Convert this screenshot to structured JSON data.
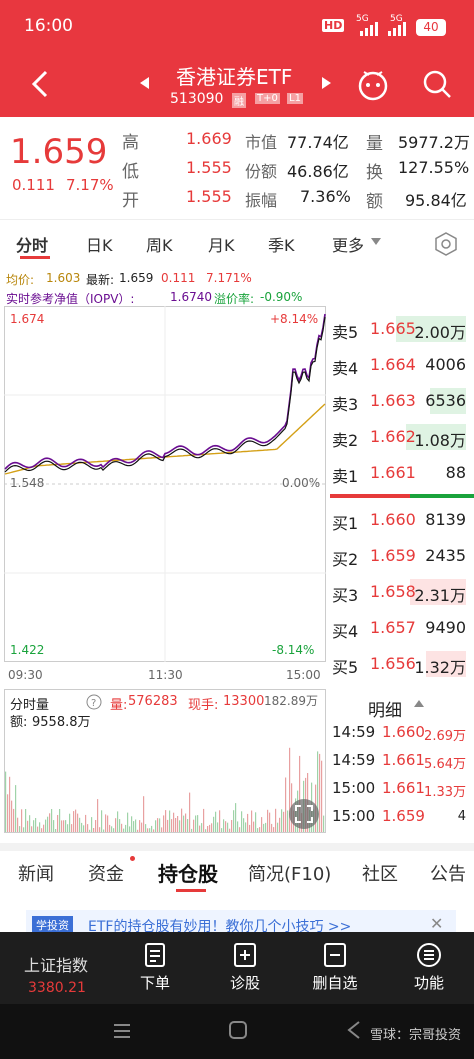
{
  "status": {
    "time": "16:00",
    "battery": "40",
    "sig1": "5G",
    "sig2": "5G",
    "hd": "HD"
  },
  "nav": {
    "title": "香港证券ETF",
    "code": "513090",
    "badges": [
      "融",
      "T+0",
      "L1"
    ]
  },
  "quote": {
    "price": "1.659",
    "change": "0.111",
    "pct": "7.17%",
    "labels": {
      "high": "高",
      "low": "低",
      "open": "开",
      "mcap": "市值",
      "shares": "份额",
      "amp": "振幅",
      "vol": "量",
      "turn": "换",
      "amt": "额"
    },
    "high": "1.669",
    "low": "1.555",
    "open": "1.555",
    "mcap": "77.74亿",
    "shares": "46.86亿",
    "amp": "7.36%",
    "vol": "5977.2万",
    "turn": "127.55%",
    "amt": "95.84亿"
  },
  "tabs": {
    "t1": "分时",
    "t2": "日K",
    "t3": "周K",
    "t4": "月K",
    "t5": "季K",
    "t6": "更多"
  },
  "chart_info": {
    "avg_label": "均价:",
    "avg": "1.603",
    "latest_label": "最新:",
    "latest": "1.659",
    "chg": "0.111",
    "pct": "7.171%",
    "iopv_label": "实时参考净值（IOPV）:",
    "iopv": "1.6740",
    "prem_label": "溢价率:",
    "prem": "-0.90%"
  },
  "chart_data": {
    "type": "line",
    "x_ticks": [
      "09:30",
      "11:30",
      "15:00"
    ],
    "y_top": "1.674",
    "y_mid": "1.548",
    "y_bot": "1.422",
    "pct_top": "+8.14%",
    "pct_mid": "0.00%",
    "pct_bot": "-8.14%",
    "ylim": [
      1.422,
      1.674
    ],
    "series": []
  },
  "orderbook": {
    "sell": [
      {
        "l": "卖5",
        "p": "1.665",
        "v": "2.00万"
      },
      {
        "l": "卖4",
        "p": "1.664",
        "v": "4006"
      },
      {
        "l": "卖3",
        "p": "1.663",
        "v": "6536"
      },
      {
        "l": "卖2",
        "p": "1.662",
        "v": "1.08万"
      },
      {
        "l": "卖1",
        "p": "1.661",
        "v": "88"
      }
    ],
    "buy": [
      {
        "l": "买1",
        "p": "1.660",
        "v": "8139"
      },
      {
        "l": "买2",
        "p": "1.659",
        "v": "2435"
      },
      {
        "l": "买3",
        "p": "1.658",
        "v": "2.31万"
      },
      {
        "l": "买4",
        "p": "1.657",
        "v": "9490"
      },
      {
        "l": "买5",
        "p": "1.656",
        "v": "1.32万"
      }
    ]
  },
  "volume": {
    "label": "分时量",
    "q_label": "量:",
    "q": "576283",
    "now_label": "现手:",
    "now": "13300",
    "amt_label": "额:",
    "amt": "9558.8万",
    "max": "182.89万"
  },
  "detail": {
    "title": "明细",
    "rows": [
      {
        "t": "14:59",
        "p": "1.660",
        "v": "2.69万"
      },
      {
        "t": "14:59",
        "p": "1.661",
        "v": "5.64万"
      },
      {
        "t": "15:00",
        "p": "1.661",
        "v": "1.33万"
      },
      {
        "t": "15:00",
        "p": "1.659",
        "v": "4"
      }
    ]
  },
  "subtabs": {
    "s1": "新闻",
    "s2": "资金",
    "s3": "持仓股",
    "s4": "简况(F10)",
    "s5": "社区",
    "s6": "公告"
  },
  "banner": {
    "tag": "学投资",
    "text": "ETF的持仓股有妙用！教你几个小技巧 >>"
  },
  "dock": {
    "index_name": "上证指数",
    "index_val": "3380.21",
    "b1": "下单",
    "b2": "诊股",
    "b3": "删自选",
    "b4": "功能"
  },
  "watermark": "雪球：宗哥投资"
}
